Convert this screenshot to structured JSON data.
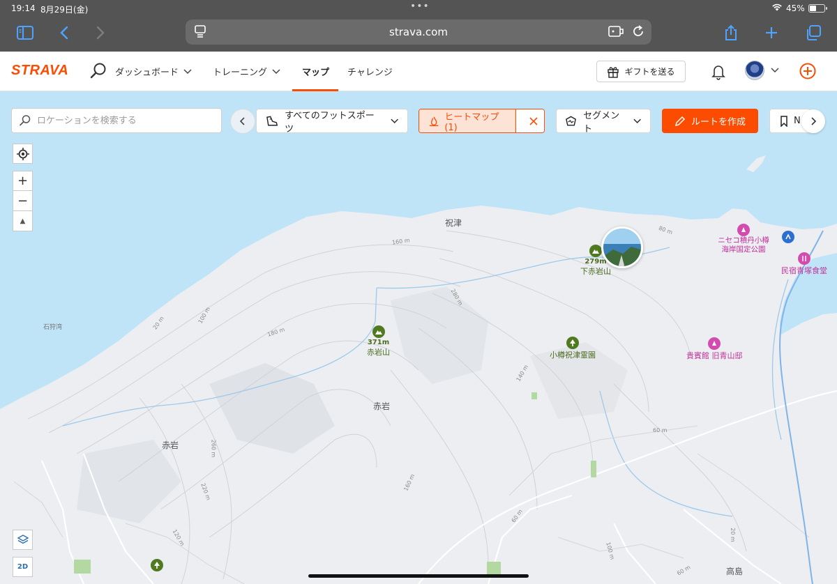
{
  "status_bar": {
    "time": "19:14",
    "date": "8月29日(金)",
    "battery_pct": "45%",
    "battery_level": 0.45
  },
  "browser": {
    "url": "strava.com",
    "icons": [
      "sidebar-icon",
      "back-icon",
      "forward-icon",
      "reader-icon",
      "extension-icon",
      "reload-icon",
      "share-icon",
      "new-tab-icon",
      "tabs-icon"
    ]
  },
  "nav": {
    "logo": "STRAVA",
    "items": [
      {
        "label": "ダッシュボード",
        "dropdown": true
      },
      {
        "label": "トレーニング",
        "dropdown": true
      },
      {
        "label": "マップ",
        "active": true
      },
      {
        "label": "チャレンジ"
      }
    ],
    "gift_label": "ギフトを送る",
    "accent": "#fc4c02"
  },
  "map_toolbar": {
    "search_placeholder": "ロケーションを検索する",
    "sport_filter": "すべてのフットスポーツ",
    "heatmap_label": "ヒートマップ (1)",
    "segments_label": "セグメント",
    "create_route_label": "ルートを作成",
    "saved_label": "N"
  },
  "map_controls": {
    "zoom_in": "+",
    "zoom_out": "−",
    "compass": "▲",
    "view_mode": "2D"
  },
  "map_labels": {
    "places": [
      {
        "name": "祝津"
      },
      {
        "name": "石狩湾"
      },
      {
        "name": "赤岩"
      },
      {
        "name": "赤岩"
      },
      {
        "name": "高島"
      }
    ],
    "peaks": [
      {
        "name": "下赤岩山",
        "elevation": "279m"
      },
      {
        "name": "赤岩山",
        "elevation": "371m"
      }
    ],
    "parks": [
      {
        "name": "小樽祝津霊園"
      }
    ],
    "attractions": [
      {
        "name": "ニセコ積丹小樽海岸国定公園"
      },
      {
        "name": "貴賓館 旧青山邸"
      },
      {
        "name": "民宿青塚食堂"
      }
    ],
    "contours": [
      "160 m",
      "80 m",
      "280 m",
      "20 m",
      "100 m",
      "180 m",
      "140 m",
      "60 m",
      "260 m",
      "220 m",
      "160 m",
      "60 m",
      "120 m",
      "100 m",
      "60 m",
      "20 m"
    ]
  }
}
